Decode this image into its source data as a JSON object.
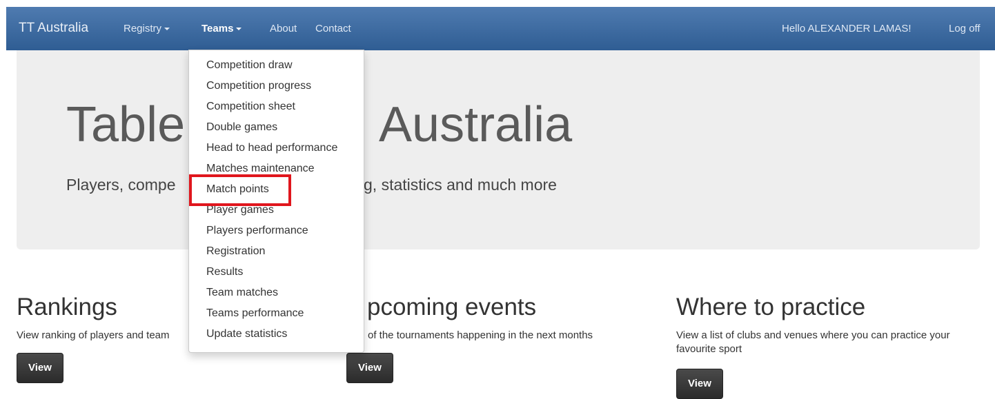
{
  "navbar": {
    "brand": "TT Australia",
    "items": [
      {
        "label": "Registry"
      },
      {
        "label": "Teams"
      },
      {
        "label": "About"
      },
      {
        "label": "Contact"
      }
    ],
    "greeting": "Hello ALEXANDER LAMAS!",
    "logoff": "Log off"
  },
  "jumbotron": {
    "title_left": "Table",
    "title_right": "Australia",
    "subtitle_left": "Players, compe",
    "subtitle_right": "g, statistics and much more"
  },
  "dropdown": {
    "items": [
      "Competition draw",
      "Competition progress",
      "Competition sheet",
      "Double games",
      "Head to head performance",
      "Matches maintenance",
      "Match points",
      "Player games",
      "Players performance",
      "Registration",
      "Results",
      "Team matches",
      "Teams performance",
      "Update statistics"
    ],
    "highlighted": "Match points",
    "highlight_color": "#e0161d"
  },
  "columns": [
    {
      "title": "Rankings",
      "text": "View ranking of players and team",
      "button": "View"
    },
    {
      "title": "pcoming events",
      "text": "of the tournaments happening in the next months",
      "button": "View"
    },
    {
      "title": "Where to practice",
      "text": "View a list of clubs and venues where you can practice your favourite sport",
      "button": "View"
    }
  ]
}
